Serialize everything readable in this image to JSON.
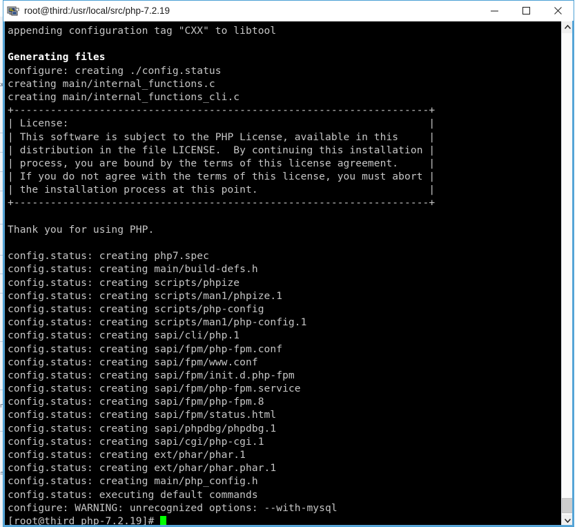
{
  "window": {
    "title": "root@third:/usr/local/src/php-7.2.19",
    "app_icon_name": "putty-terminal-icon",
    "accent_color": "#5ba7d8",
    "titlebar_bg": "#ffffff",
    "controls": {
      "minimize_label": "—",
      "maximize_label": "□",
      "close_label": "✕"
    }
  },
  "terminal": {
    "background_color": "#000000",
    "foreground_color": "#c6c6c6",
    "bold_color": "#ffffff",
    "cursor_color": "#00ff00",
    "font_size_px": 14.6,
    "line_height_px": 19.2,
    "columns": 90,
    "lines": [
      {
        "text": "appending configuration tag \"CXX\" to libtool",
        "bold": false
      },
      {
        "text": "",
        "bold": false
      },
      {
        "text": "Generating files",
        "bold": true
      },
      {
        "text": "configure: creating ./config.status",
        "bold": false
      },
      {
        "text": "creating main/internal_functions.c",
        "bold": false
      },
      {
        "text": "creating main/internal_functions_cli.c",
        "bold": false
      },
      {
        "text": "+--------------------------------------------------------------------+",
        "bold": false
      },
      {
        "text": "| License:                                                           |",
        "bold": false
      },
      {
        "text": "| This software is subject to the PHP License, available in this     |",
        "bold": false
      },
      {
        "text": "| distribution in the file LICENSE.  By continuing this installation |",
        "bold": false
      },
      {
        "text": "| process, you are bound by the terms of this license agreement.     |",
        "bold": false
      },
      {
        "text": "| If you do not agree with the terms of this license, you must abort |",
        "bold": false
      },
      {
        "text": "| the installation process at this point.                            |",
        "bold": false
      },
      {
        "text": "+--------------------------------------------------------------------+",
        "bold": false
      },
      {
        "text": "",
        "bold": false
      },
      {
        "text": "Thank you for using PHP.",
        "bold": false
      },
      {
        "text": "",
        "bold": false
      },
      {
        "text": "config.status: creating php7.spec",
        "bold": false
      },
      {
        "text": "config.status: creating main/build-defs.h",
        "bold": false
      },
      {
        "text": "config.status: creating scripts/phpize",
        "bold": false
      },
      {
        "text": "config.status: creating scripts/man1/phpize.1",
        "bold": false
      },
      {
        "text": "config.status: creating scripts/php-config",
        "bold": false
      },
      {
        "text": "config.status: creating scripts/man1/php-config.1",
        "bold": false
      },
      {
        "text": "config.status: creating sapi/cli/php.1",
        "bold": false
      },
      {
        "text": "config.status: creating sapi/fpm/php-fpm.conf",
        "bold": false
      },
      {
        "text": "config.status: creating sapi/fpm/www.conf",
        "bold": false
      },
      {
        "text": "config.status: creating sapi/fpm/init.d.php-fpm",
        "bold": false
      },
      {
        "text": "config.status: creating sapi/fpm/php-fpm.service",
        "bold": false
      },
      {
        "text": "config.status: creating sapi/fpm/php-fpm.8",
        "bold": false
      },
      {
        "text": "config.status: creating sapi/fpm/status.html",
        "bold": false
      },
      {
        "text": "config.status: creating sapi/phpdbg/phpdbg.1",
        "bold": false
      },
      {
        "text": "config.status: creating sapi/cgi/php-cgi.1",
        "bold": false
      },
      {
        "text": "config.status: creating ext/phar/phar.1",
        "bold": false
      },
      {
        "text": "config.status: creating ext/phar/phar.phar.1",
        "bold": false
      },
      {
        "text": "config.status: creating main/php_config.h",
        "bold": false
      },
      {
        "text": "config.status: executing default commands",
        "bold": false
      },
      {
        "text": "configure: WARNING: unrecognized options: --with-mysql",
        "bold": false
      }
    ],
    "prompt": "[root@third php-7.2.19]# "
  },
  "scrollbar": {
    "up_arrow_name": "scroll-up-arrow",
    "down_arrow_name": "scroll-down-arrow",
    "thumb_position": "bottom"
  }
}
